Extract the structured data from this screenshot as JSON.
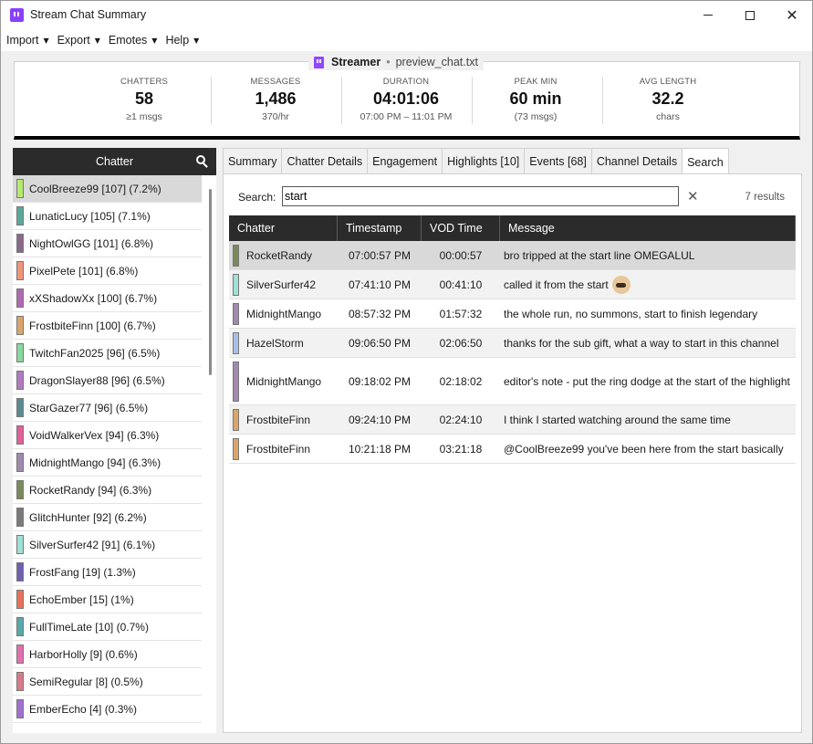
{
  "window": {
    "title": "Stream Chat Summary"
  },
  "menu": [
    {
      "label": "Import"
    },
    {
      "label": "Export"
    },
    {
      "label": "Emotes"
    },
    {
      "label": "Help"
    }
  ],
  "header": {
    "streamer": "Streamer",
    "separator": "•",
    "file": "preview_chat.txt"
  },
  "stats": [
    {
      "label": "CHATTERS",
      "value": "58",
      "sub": "≥1 msgs"
    },
    {
      "label": "MESSAGES",
      "value": "1,486",
      "sub": "370/hr"
    },
    {
      "label": "DURATION",
      "value": "04:01:06",
      "sub": "07:00 PM – 11:01 PM"
    },
    {
      "label": "PEAK MIN",
      "value": "60 min",
      "sub": "(73 msgs)"
    },
    {
      "label": "AVG LENGTH",
      "value": "32.2",
      "sub": "chars"
    }
  ],
  "chatter_panel": {
    "title": "Chatter",
    "items": [
      {
        "label": "CoolBreeze99 [107] (7.2%)",
        "color": "#b5e86e"
      },
      {
        "label": "LunaticLucy [105] (7.1%)",
        "color": "#5aa89a"
      },
      {
        "label": "NightOwlGG [101] (6.8%)",
        "color": "#8a6a8a"
      },
      {
        "label": "PixelPete [101] (6.8%)",
        "color": "#f0957a"
      },
      {
        "label": "xXShadowXx [100] (6.7%)",
        "color": "#b06ab0"
      },
      {
        "label": "FrostbiteFinn [100] (6.7%)",
        "color": "#d9a56a"
      },
      {
        "label": "TwitchFan2025 [96] (6.5%)",
        "color": "#8ad6a0"
      },
      {
        "label": "DragonSlayer88 [96] (6.5%)",
        "color": "#b07ac0"
      },
      {
        "label": "StarGazer77 [96] (6.5%)",
        "color": "#5a8a90"
      },
      {
        "label": "VoidWalkerVex [94] (6.3%)",
        "color": "#e0609a"
      },
      {
        "label": "MidnightMango [94] (6.3%)",
        "color": "#a08ab0"
      },
      {
        "label": "RocketRandy [94] (6.3%)",
        "color": "#7a8a5a"
      },
      {
        "label": "GlitchHunter [92] (6.2%)",
        "color": "#7a7a7a"
      },
      {
        "label": "SilverSurfer42 [91] (6.1%)",
        "color": "#a0e0d6"
      },
      {
        "label": "FrostFang [19] (1.3%)",
        "color": "#7060b0"
      },
      {
        "label": "EchoEmber [15] (1%)",
        "color": "#e8705a"
      },
      {
        "label": "FullTimeLate [10] (0.7%)",
        "color": "#5aa8a8"
      },
      {
        "label": "HarborHolly [9] (0.6%)",
        "color": "#e070b0"
      },
      {
        "label": "SemiRegular [8] (0.5%)",
        "color": "#d87a8a"
      },
      {
        "label": "EmberEcho [4] (0.3%)",
        "color": "#a070d0"
      }
    ]
  },
  "tabs": [
    {
      "label": "Summary"
    },
    {
      "label": "Chatter Details"
    },
    {
      "label": "Engagement"
    },
    {
      "label": "Highlights [10]"
    },
    {
      "label": "Events [68]"
    },
    {
      "label": "Channel Details"
    },
    {
      "label": "Search"
    }
  ],
  "search": {
    "label": "Search:",
    "value": "start",
    "clear": "✕",
    "results": "7 results"
  },
  "results_table": {
    "columns": [
      "Chatter",
      "Timestamp",
      "VOD Time",
      "Message"
    ],
    "rows": [
      {
        "chatter": "RocketRandy",
        "color": "#7a8a5a",
        "timestamp": "07:00:57 PM",
        "vod": "00:00:57",
        "message": "bro tripped at the start line OMEGALUL",
        "emote": ""
      },
      {
        "chatter": "SilverSurfer42",
        "color": "#a0e0d6",
        "timestamp": "07:41:10 PM",
        "vod": "00:41:10",
        "message": "called it from the start",
        "emote": "face-emote"
      },
      {
        "chatter": "MidnightMango",
        "color": "#a08ab0",
        "timestamp": "08:57:32 PM",
        "vod": "01:57:32",
        "message": "the whole run, no summons, start to finish legendary",
        "emote": ""
      },
      {
        "chatter": "HazelStorm",
        "color": "#a8c0e8",
        "timestamp": "09:06:50 PM",
        "vod": "02:06:50",
        "message": "thanks for the sub gift, what a way to start in this channel",
        "emote": ""
      },
      {
        "chatter": "MidnightMango",
        "color": "#a08ab0",
        "timestamp": "09:18:02 PM",
        "vod": "02:18:02",
        "message": "editor's note - put the ring dodge at the start of the highlight",
        "emote": ""
      },
      {
        "chatter": "FrostbiteFinn",
        "color": "#d9a56a",
        "timestamp": "09:24:10 PM",
        "vod": "02:24:10",
        "message": "I think I started watching around the same time",
        "emote": ""
      },
      {
        "chatter": "FrostbiteFinn",
        "color": "#d9a56a",
        "timestamp": "10:21:18 PM",
        "vod": "03:21:18",
        "message": "@CoolBreeze99 you've been here from the start basically",
        "emote": ""
      }
    ]
  }
}
